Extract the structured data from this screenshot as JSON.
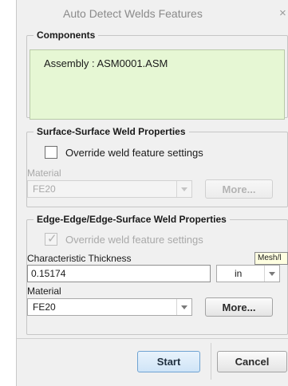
{
  "dialog": {
    "title": "Auto Detect Welds Features",
    "close_glyph": "×"
  },
  "components": {
    "legend": "Components",
    "items": [
      "Assembly : ASM0001.ASM"
    ]
  },
  "surface_surface": {
    "legend": "Surface-Surface Weld Properties",
    "override_label": "Override weld feature settings",
    "override_checked": false,
    "material_label": "Material",
    "material_value": "FE20",
    "more_label": "More..."
  },
  "edge_edge": {
    "legend": "Edge-Edge/Edge-Surface Weld Properties",
    "override_label": "Override weld feature settings",
    "override_checked": true,
    "thickness_label": "Characteristic Thickness",
    "thickness_value": "0.15174",
    "units_value": "in",
    "tooltip": "Mesh/l",
    "material_label": "Material",
    "material_value": "FE20",
    "more_label": "More..."
  },
  "footer": {
    "start_label": "Start",
    "cancel_label": "Cancel"
  },
  "colors": {
    "components_bg": "#e6f7d4",
    "start_accent": "#cfe4f7"
  }
}
